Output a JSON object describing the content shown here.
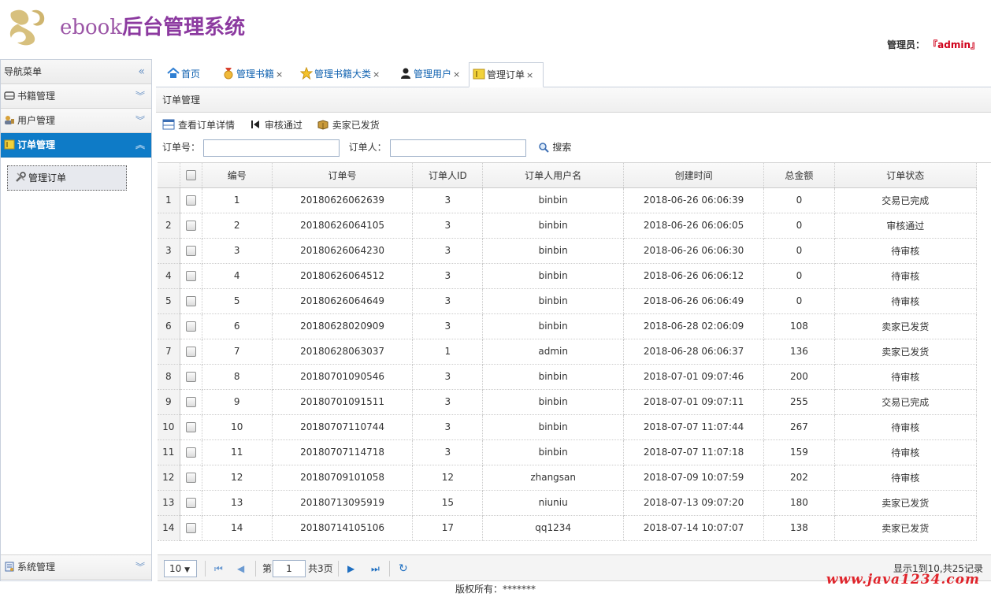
{
  "header": {
    "logo_en": "ebook",
    "logo_cn": "后台管理系统",
    "admin_label": "管理员：",
    "admin_name": "『admin』"
  },
  "sidebar": {
    "title": "导航菜单",
    "sections": [
      {
        "label": "书籍管理",
        "icon": "book-icon"
      },
      {
        "label": "用户管理",
        "icon": "users-icon"
      },
      {
        "label": "订单管理",
        "icon": "order-icon",
        "active": true
      }
    ],
    "active_item": "管理订单",
    "bottom_section": "系统管理"
  },
  "tabs": [
    {
      "label": "首页",
      "icon": "home-icon",
      "closable": false
    },
    {
      "label": "管理书籍",
      "icon": "medal-icon",
      "closable": true
    },
    {
      "label": "管理书籍大类",
      "icon": "star-icon",
      "closable": true
    },
    {
      "label": "管理用户",
      "icon": "user-icon",
      "closable": true
    },
    {
      "label": "管理订单",
      "icon": "order-icon",
      "closable": true,
      "active": true
    }
  ],
  "panel_title": "订单管理",
  "toolbar": {
    "detail": "查看订单详情",
    "approve": "审核通过",
    "shipped": "卖家已发货"
  },
  "search": {
    "order_no_label": "订单号：",
    "user_label": "订单人：",
    "button": "搜索"
  },
  "columns": [
    "编号",
    "订单号",
    "订单人ID",
    "订单人用户名",
    "创建时间",
    "总金额",
    "订单状态"
  ],
  "rows": [
    {
      "rn": "1",
      "id": "1",
      "no": "20180626062639",
      "uid": "3",
      "user": "binbin",
      "time": "2018-06-26 06:06:39",
      "total": "0",
      "status": "交易已完成"
    },
    {
      "rn": "2",
      "id": "2",
      "no": "20180626064105",
      "uid": "3",
      "user": "binbin",
      "time": "2018-06-26 06:06:05",
      "total": "0",
      "status": "审核通过"
    },
    {
      "rn": "3",
      "id": "3",
      "no": "20180626064230",
      "uid": "3",
      "user": "binbin",
      "time": "2018-06-26 06:06:30",
      "total": "0",
      "status": "待审核"
    },
    {
      "rn": "4",
      "id": "4",
      "no": "20180626064512",
      "uid": "3",
      "user": "binbin",
      "time": "2018-06-26 06:06:12",
      "total": "0",
      "status": "待审核"
    },
    {
      "rn": "5",
      "id": "5",
      "no": "20180626064649",
      "uid": "3",
      "user": "binbin",
      "time": "2018-06-26 06:06:49",
      "total": "0",
      "status": "待审核"
    },
    {
      "rn": "6",
      "id": "6",
      "no": "20180628020909",
      "uid": "3",
      "user": "binbin",
      "time": "2018-06-28 02:06:09",
      "total": "108",
      "status": "卖家已发货"
    },
    {
      "rn": "7",
      "id": "7",
      "no": "20180628063037",
      "uid": "1",
      "user": "admin",
      "time": "2018-06-28 06:06:37",
      "total": "136",
      "status": "卖家已发货"
    },
    {
      "rn": "8",
      "id": "8",
      "no": "20180701090546",
      "uid": "3",
      "user": "binbin",
      "time": "2018-07-01 09:07:46",
      "total": "200",
      "status": "待审核"
    },
    {
      "rn": "9",
      "id": "9",
      "no": "20180701091511",
      "uid": "3",
      "user": "binbin",
      "time": "2018-07-01 09:07:11",
      "total": "255",
      "status": "交易已完成"
    },
    {
      "rn": "10",
      "id": "10",
      "no": "20180707110744",
      "uid": "3",
      "user": "binbin",
      "time": "2018-07-07 11:07:44",
      "total": "267",
      "status": "待审核"
    },
    {
      "rn": "11",
      "id": "11",
      "no": "20180707114718",
      "uid": "3",
      "user": "binbin",
      "time": "2018-07-07 11:07:18",
      "total": "159",
      "status": "待审核"
    },
    {
      "rn": "12",
      "id": "12",
      "no": "20180709101058",
      "uid": "12",
      "user": "zhangsan",
      "time": "2018-07-09 10:07:59",
      "total": "202",
      "status": "待审核"
    },
    {
      "rn": "13",
      "id": "13",
      "no": "20180713095919",
      "uid": "15",
      "user": "niuniu",
      "time": "2018-07-13 09:07:20",
      "total": "180",
      "status": "卖家已发货"
    },
    {
      "rn": "14",
      "id": "14",
      "no": "20180714105106",
      "uid": "17",
      "user": "qq1234",
      "time": "2018-07-14 10:07:07",
      "total": "138",
      "status": "卖家已发货"
    }
  ],
  "pager": {
    "page_size": "10",
    "page_label": "第",
    "page_value": "1",
    "total_pages": "共3页",
    "info": "显示1到10,共25记录"
  },
  "footer": "版权所有：*******",
  "watermark": "www.java1234.com",
  "colors": {
    "accent": "#0e7bc7",
    "brand": "#8c3aa0",
    "admin": "#d0021b"
  }
}
